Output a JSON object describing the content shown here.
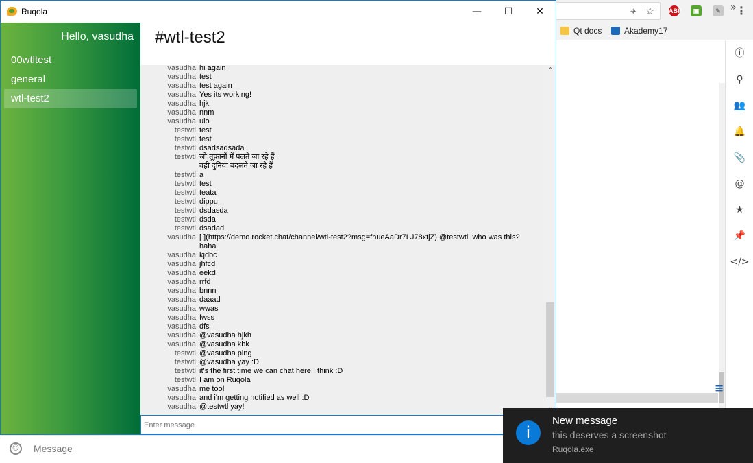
{
  "window": {
    "title": "Ruqola"
  },
  "sidebar": {
    "greeting": "Hello, vasudha",
    "rooms": [
      {
        "label": "00wtltest",
        "active": false
      },
      {
        "label": "general",
        "active": false
      },
      {
        "label": "wtl-test2",
        "active": true
      }
    ]
  },
  "room": {
    "title": "#wtl-test2"
  },
  "messages": [
    {
      "author": "vasudha",
      "text": "hi again"
    },
    {
      "author": "vasudha",
      "text": "test"
    },
    {
      "author": "vasudha",
      "text": "test again"
    },
    {
      "author": "vasudha",
      "text": "Yes its working!"
    },
    {
      "author": "vasudha",
      "text": "hjk"
    },
    {
      "author": "vasudha",
      "text": "nnm"
    },
    {
      "author": "vasudha",
      "text": "uio"
    },
    {
      "author": "testwtl",
      "text": "test"
    },
    {
      "author": "testwtl",
      "text": "test"
    },
    {
      "author": "testwtl",
      "text": "dsadsadsada"
    },
    {
      "author": "testwtl",
      "text": "जो तूफ़ानों में पलते जा रहे हैं\nवही दुनिया बदलते जा रहे हैं"
    },
    {
      "author": "testwtl",
      "text": "a"
    },
    {
      "author": "testwtl",
      "text": "test"
    },
    {
      "author": "testwtl",
      "text": "teata"
    },
    {
      "author": "testwtl",
      "text": "dippu"
    },
    {
      "author": "testwtl",
      "text": "dsdasda"
    },
    {
      "author": "testwtl",
      "text": "dsda"
    },
    {
      "author": "testwtl",
      "text": "dsadad"
    },
    {
      "author": "vasudha",
      "text": "[ ](https://demo.rocket.chat/channel/wtl-test2?msg=fhueAaDr7LJ78xtjZ) @testwtl  who was this?\nhaha"
    },
    {
      "author": "vasudha",
      "text": "kjdbc"
    },
    {
      "author": "vasudha",
      "text": "jhfcd"
    },
    {
      "author": "vasudha",
      "text": "eekd"
    },
    {
      "author": "vasudha",
      "text": "rrfd"
    },
    {
      "author": "vasudha",
      "text": "bnnn"
    },
    {
      "author": "vasudha",
      "text": "daaad"
    },
    {
      "author": "vasudha",
      "text": "wwas"
    },
    {
      "author": "vasudha",
      "text": "fwss"
    },
    {
      "author": "vasudha",
      "text": "dfs"
    },
    {
      "author": "vasudha",
      "text": "@vasudha hjkh"
    },
    {
      "author": "vasudha",
      "text": "@vasudha kbk"
    },
    {
      "author": "testwtl",
      "text": "@vasudha ping"
    },
    {
      "author": "testwtl",
      "text": "@vasudha yay :D"
    },
    {
      "author": "testwtl",
      "text": "it's the first time we can chat here I think :D"
    },
    {
      "author": "testwtl",
      "text": "I am on Ruqola"
    },
    {
      "author": "vasudha",
      "text": "me too!"
    },
    {
      "author": "vasudha",
      "text": "and i'm getting notified as well :D"
    },
    {
      "author": "vasudha",
      "text": "@testwtl yay!"
    }
  ],
  "input": {
    "placeholder": "Enter message"
  },
  "browser": {
    "bookmarks": [
      {
        "label": "Qt docs",
        "icon": "folder-icon"
      },
      {
        "label": "Akademy17",
        "icon": "kde-icon"
      }
    ],
    "compose_placeholder": "Message"
  },
  "notification": {
    "title": "New message",
    "body": "this deserves a screenshot",
    "source": "Ruqola.exe",
    "icon": "info-icon",
    "accent": "#0a7ad8"
  },
  "colors": {
    "window_border": "#1979ca",
    "sidebar_light": "#6cb33f",
    "sidebar_dark": "#006d38",
    "message_bg": "#efefef"
  }
}
